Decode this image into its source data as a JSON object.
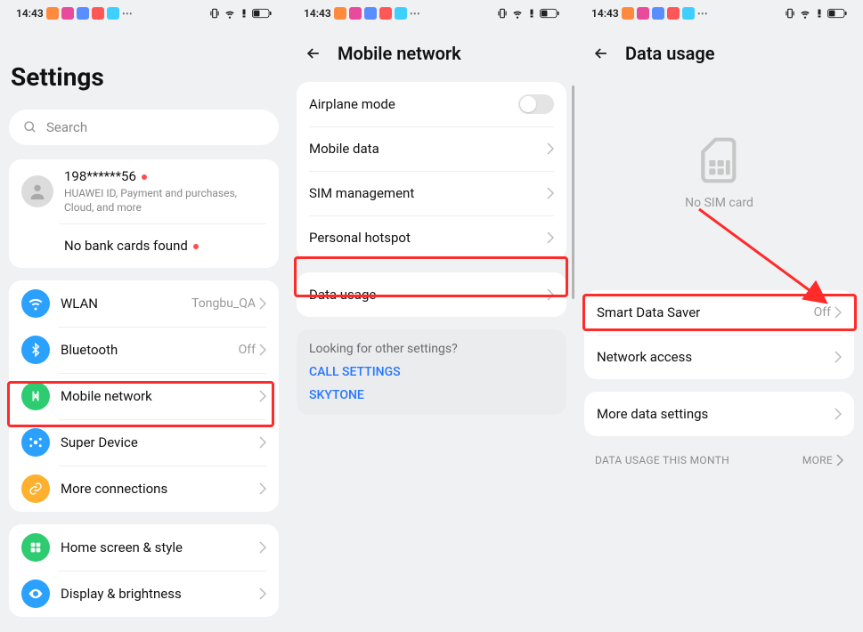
{
  "status": {
    "time": "14:43",
    "app_colors": [
      "#ff8a3d",
      "#e84b9b",
      "#5a8dff",
      "#ff5757",
      "#3ecfff"
    ]
  },
  "screen1": {
    "title": "Settings",
    "search_placeholder": "Search",
    "account": {
      "id_masked": "198******56",
      "subtitle": "HUAWEI ID, Payment and purchases, Cloud, and more",
      "bank_text": "No bank cards found"
    },
    "group_network": [
      {
        "key": "wlan",
        "label": "WLAN",
        "value": "Tongbu_QA",
        "color": "#2aa0ff"
      },
      {
        "key": "bluetooth",
        "label": "Bluetooth",
        "value": "Off",
        "color": "#2aa0ff"
      },
      {
        "key": "mobile-network",
        "label": "Mobile network",
        "value": "",
        "color": "#2ecc71"
      },
      {
        "key": "super-device",
        "label": "Super Device",
        "value": "",
        "color": "#2aa0ff"
      },
      {
        "key": "more-connections",
        "label": "More connections",
        "value": "",
        "color": "#ffb02e"
      }
    ],
    "group_display": [
      {
        "key": "home-screen",
        "label": "Home screen & style",
        "color": "#2ecc71"
      },
      {
        "key": "display",
        "label": "Display & brightness",
        "color": "#2aa0ff"
      }
    ]
  },
  "screen2": {
    "title": "Mobile network",
    "rows": [
      {
        "key": "airplane-mode",
        "label": "Airplane mode",
        "control": "toggle"
      },
      {
        "key": "mobile-data",
        "label": "Mobile data",
        "control": "chevron"
      },
      {
        "key": "sim-management",
        "label": "SIM management",
        "control": "chevron"
      },
      {
        "key": "personal-hotspot",
        "label": "Personal hotspot",
        "control": "chevron"
      }
    ],
    "data_usage_label": "Data usage",
    "footer": {
      "question": "Looking for other settings?",
      "links": [
        "CALL SETTINGS",
        "SKYTONE"
      ]
    }
  },
  "screen3": {
    "title": "Data usage",
    "empty_sim": "No SIM card",
    "rows1": [
      {
        "key": "smart-data-saver",
        "label": "Smart Data Saver",
        "value": "Off"
      },
      {
        "key": "network-access",
        "label": "Network access",
        "value": ""
      }
    ],
    "rows2": [
      {
        "key": "more-data-settings",
        "label": "More data settings",
        "value": ""
      }
    ],
    "section_header": "DATA USAGE THIS MONTH",
    "more_label": "MORE"
  }
}
